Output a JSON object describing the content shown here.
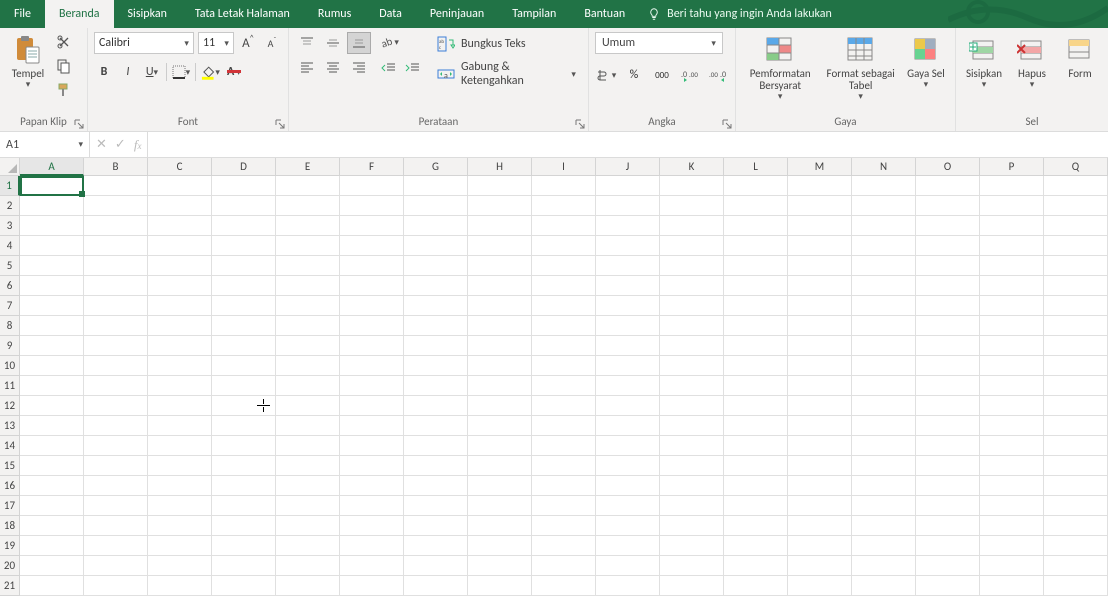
{
  "tabs": {
    "file": "File",
    "home": "Beranda",
    "insert": "Sisipkan",
    "page_layout": "Tata Letak Halaman",
    "formulas": "Rumus",
    "data": "Data",
    "review": "Peninjauan",
    "view": "Tampilan",
    "help": "Bantuan",
    "tell_me": "Beri tahu yang ingin Anda lakukan"
  },
  "ribbon": {
    "clipboard": {
      "label": "Papan Klip",
      "paste": "Tempel"
    },
    "font": {
      "label": "Font",
      "name": "Calibri",
      "size": "11"
    },
    "alignment": {
      "label": "Perataan",
      "wrap": "Bungkus Teks",
      "merge": "Gabung & Ketengahkan"
    },
    "number": {
      "label": "Angka",
      "format": "Umum",
      "percent": "%",
      "comma": "000"
    },
    "styles": {
      "label": "Gaya",
      "cond_format": "Pemformatan Bersyarat",
      "table": "Format sebagai Tabel",
      "cell_styles": "Gaya Sel"
    },
    "cells": {
      "label": "Sel",
      "insert": "Sisipkan",
      "delete": "Hapus",
      "format": "Form"
    }
  },
  "formula_bar": {
    "namebox": "A1",
    "formula": ""
  },
  "grid": {
    "columns": [
      "A",
      "B",
      "C",
      "D",
      "E",
      "F",
      "G",
      "H",
      "I",
      "J",
      "K",
      "L",
      "M",
      "N",
      "O",
      "P",
      "Q"
    ],
    "rows": [
      "1",
      "2",
      "3",
      "4",
      "5",
      "6",
      "7",
      "8",
      "9",
      "10",
      "11",
      "12",
      "13",
      "14",
      "15",
      "16",
      "17",
      "18",
      "19",
      "20",
      "21"
    ],
    "active_cell": "A1"
  }
}
